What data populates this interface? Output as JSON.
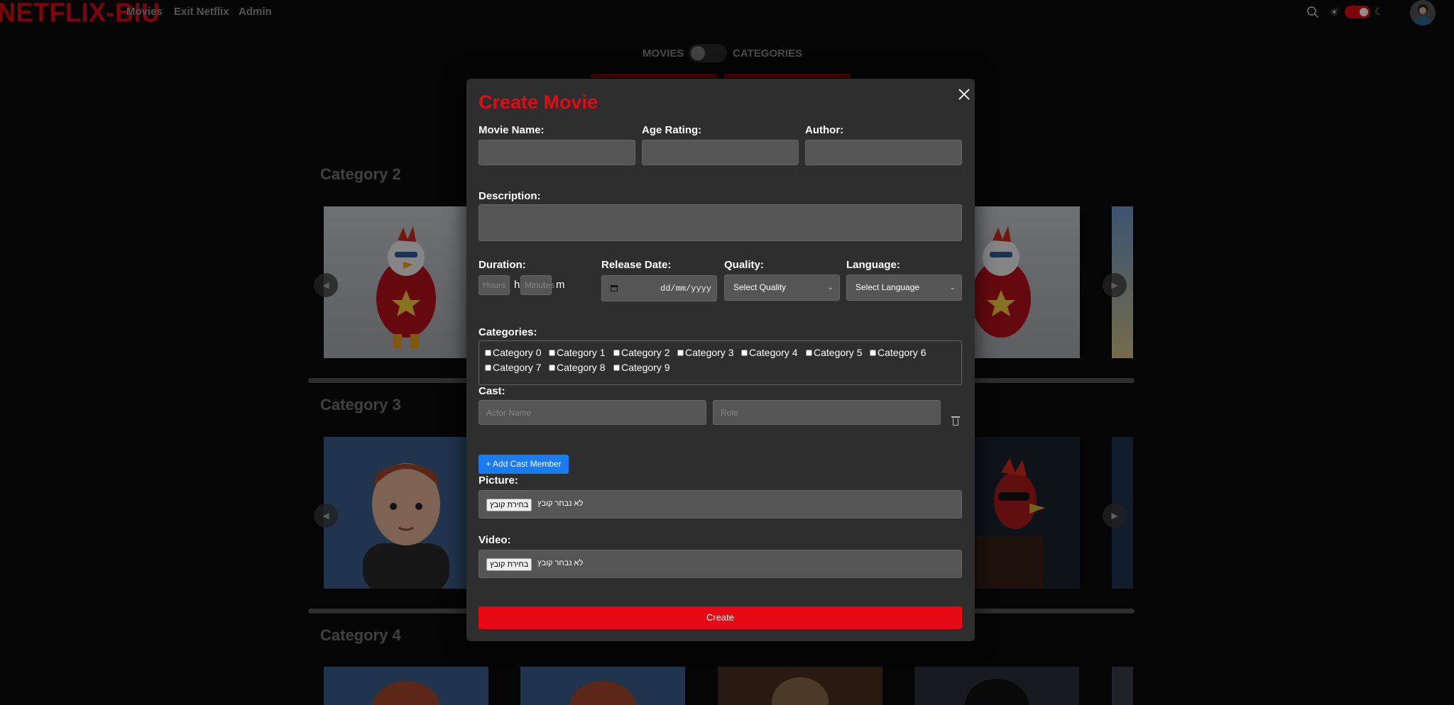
{
  "nav": {
    "logo": "NETFLIX-BIU",
    "links": [
      "Movies",
      "Exit Netflix",
      "Admin"
    ]
  },
  "mode_toggle": {
    "left_label": "MOVIES",
    "right_label": "CATEGORIES"
  },
  "rows": [
    {
      "title": "Category 2"
    },
    {
      "title": "Category 3"
    },
    {
      "title": "Category 4"
    }
  ],
  "modal": {
    "title": "Create Movie",
    "fields": {
      "movie_name": {
        "label": "Movie Name:",
        "value": ""
      },
      "age_rating": {
        "label": "Age Rating:",
        "value": ""
      },
      "author": {
        "label": "Author:",
        "value": ""
      },
      "description": {
        "label": "Description:",
        "value": ""
      },
      "duration": {
        "label": "Duration:",
        "hours_placeholder": "Hours",
        "minutes_placeholder": "Minutes",
        "hours_unit": "h",
        "minutes_unit": "m"
      },
      "release_date": {
        "label": "Release Date:",
        "placeholder": "dd/mm/yyyy"
      },
      "quality": {
        "label": "Quality:",
        "selected": "Select Quality"
      },
      "language": {
        "label": "Language:",
        "selected": "Select Language"
      },
      "categories": {
        "label": "Categories:",
        "options": [
          "Category 0",
          "Category 1",
          "Category 2",
          "Category 3",
          "Category 4",
          "Category 5",
          "Category 6",
          "Category 7",
          "Category 8",
          "Category 9"
        ]
      },
      "cast": {
        "label": "Cast:",
        "actor_placeholder": "Actor Name",
        "role_placeholder": "Role"
      },
      "picture": {
        "label": "Picture:",
        "button": "בחירת קובץ",
        "status": "לא נבחר קובץ"
      },
      "video": {
        "label": "Video:",
        "button": "בחירת קובץ",
        "status": "לא נבחר קובץ"
      }
    },
    "add_cast_label": "+ Add Cast Member",
    "create_label": "Create"
  },
  "colors": {
    "brand": "#e50914",
    "modal_bg": "#2e2e2e",
    "input_bg": "#555555",
    "accent_blue": "#1a7cf0"
  },
  "icons": [
    "search-icon",
    "sun-icon",
    "moon-icon",
    "close-icon",
    "trash-icon",
    "calendar-icon",
    "chevron-down-icon",
    "arrow-left-icon",
    "arrow-right-icon"
  ]
}
